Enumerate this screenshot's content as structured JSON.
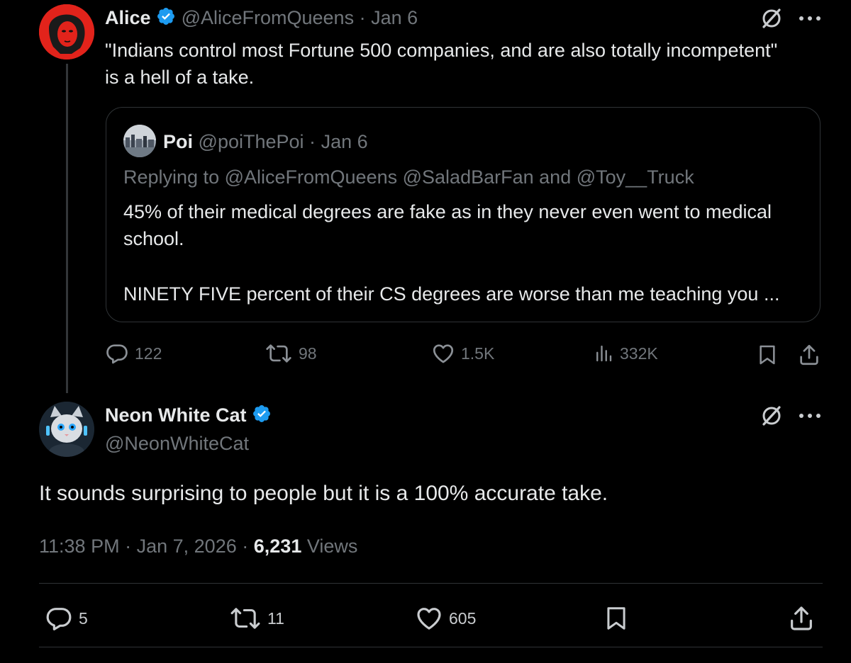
{
  "parent_post": {
    "author_name": "Alice",
    "handle": "@AliceFromQueens",
    "sep": "·",
    "date": "Jan 6",
    "text_line1": "\"Indians control most Fortune 500 companies, and are also totally incompetent\"",
    "text_line2": "is a hell of a take.",
    "quoted": {
      "author_name": "Poi",
      "handle": "@poiThePoi",
      "sep": "·",
      "date": "Jan 6",
      "replying_prefix": "Replying to",
      "reply_to_1": "@AliceFromQueens",
      "reply_to_2": "@SaladBarFan",
      "reply_and": "and",
      "reply_to_3": "@Toy__Truck",
      "text_line1": "45% of their medical degrees are fake as in they never even went to medical",
      "text_line2": "school.",
      "text_line3": "NINETY FIVE percent of their CS degrees are worse than me teaching you ..."
    },
    "actions": {
      "replies": "122",
      "reposts": "98",
      "likes": "1.5K",
      "views": "332K"
    }
  },
  "main_post": {
    "author_name": "Neon White Cat",
    "handle": "@NeonWhiteCat",
    "text": "It sounds surprising to people but it is a 100% accurate take.",
    "time": "11:38 PM",
    "sep1": "·",
    "date": "Jan 7, 2026",
    "sep2": "·",
    "views_count": "6,231",
    "views_label": "Views",
    "actions": {
      "replies": "5",
      "reposts": "11",
      "likes": "605"
    }
  },
  "colors": {
    "background": "#000000",
    "text": "#e7e9ea",
    "muted": "#71767b",
    "verified": "#1d9bf0",
    "border": "#2f3336"
  },
  "icons": [
    "verified-icon",
    "grok-icon",
    "more-icon",
    "reply-icon",
    "repost-icon",
    "like-icon",
    "views-icon",
    "bookmark-icon",
    "share-icon"
  ]
}
